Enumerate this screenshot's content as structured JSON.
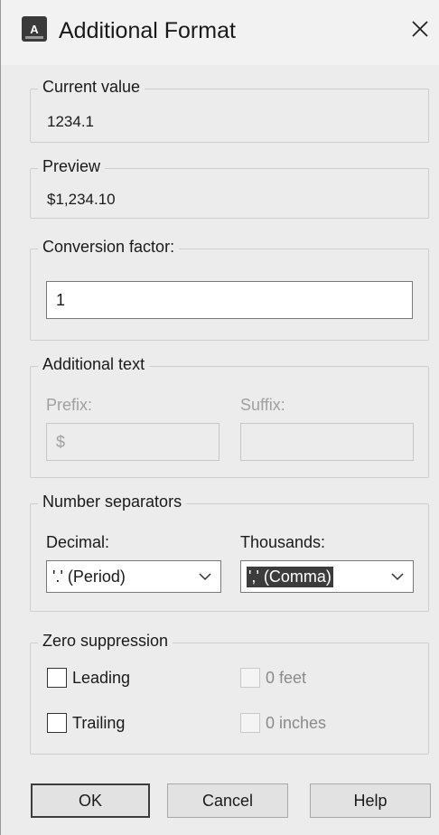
{
  "window": {
    "title": "Additional Format",
    "icon": "autocad-app-icon",
    "icon_letter": "A"
  },
  "current_value": {
    "legend": "Current value",
    "value": "1234.1"
  },
  "preview": {
    "legend": "Preview",
    "value": "$1,234.10"
  },
  "conversion": {
    "legend": "Conversion factor:",
    "value": "1"
  },
  "additional_text": {
    "legend": "Additional text",
    "prefix_label": "Prefix:",
    "prefix_value": "$",
    "suffix_label": "Suffix:",
    "suffix_value": ""
  },
  "separators": {
    "legend": "Number separators",
    "decimal_label": "Decimal:",
    "decimal_value": "'.' (Period)",
    "thousands_label": "Thousands:",
    "thousands_value": "',' (Comma)"
  },
  "zero_suppression": {
    "legend": "Zero suppression",
    "leading": "Leading",
    "trailing": "Trailing",
    "feet": "0 feet",
    "inches": "0 inches",
    "leading_checked": false,
    "trailing_checked": false,
    "feet_checked": false,
    "inches_checked": false
  },
  "buttons": {
    "ok": "OK",
    "cancel": "Cancel",
    "help": "Help"
  }
}
